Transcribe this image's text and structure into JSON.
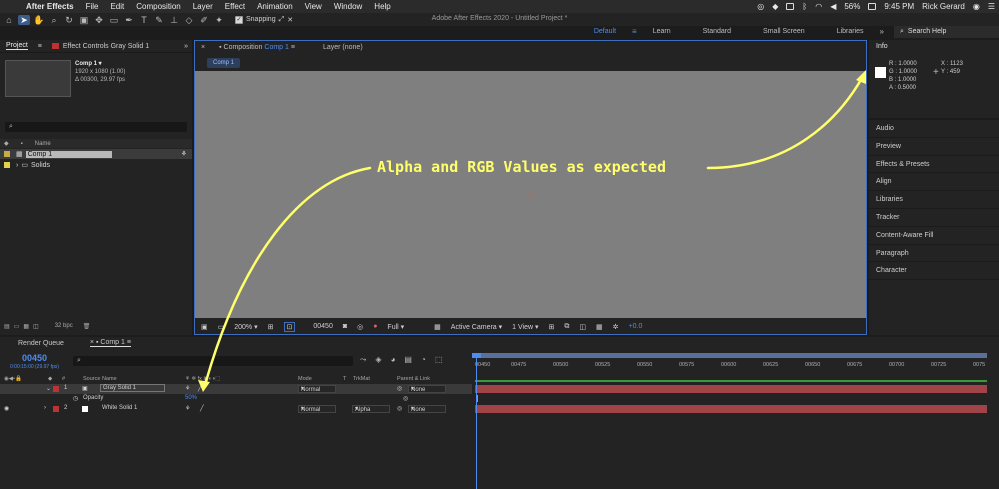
{
  "menubar": {
    "app": "After Effects",
    "items": [
      "File",
      "Edit",
      "Composition",
      "Layer",
      "Effect",
      "Animation",
      "View",
      "Window",
      "Help"
    ],
    "battery": "56%",
    "time": "9:45 PM",
    "user": "Rick Gerard"
  },
  "toolbar": {
    "window_title": "Adobe After Effects 2020 - Untitled Project *",
    "snapping_label": "Snapping"
  },
  "workspaces": {
    "items": [
      "Default",
      "Learn",
      "Standard",
      "Small Screen",
      "Libraries"
    ],
    "active": "Default",
    "search_placeholder": "Search Help"
  },
  "project": {
    "tab_project": "Project",
    "tab_effects": "Effect Controls Gray Solid 1",
    "comp_name": "Comp 1 ▾",
    "comp_res": "1920 x 1080 (1.00)",
    "comp_dur": "Δ 00300, 29.97 fps",
    "search_icon": "⌕",
    "col_name": "Name",
    "items": [
      {
        "name": "Comp 1",
        "color": "#c9a94a"
      },
      {
        "name": "Solids",
        "color": "#e0d24a"
      }
    ],
    "bpc": "32 bpc"
  },
  "viewer": {
    "tab_comp": "Composition",
    "tab_comp_name": "Comp 1",
    "tab_layer": "Layer (none)",
    "pill": "Comp 1",
    "zoom": "200%",
    "frame": "00450",
    "resolution": "Full",
    "camera": "Active Camera",
    "views": "1 View",
    "exposure": "+0.0"
  },
  "info": {
    "title": "Info",
    "r": "R : 1.0000",
    "g": "G : 1.0000",
    "b": "B : 1.0000",
    "a": "A :  0.5000",
    "x": "X : 1123",
    "y": "Y :  459"
  },
  "right_panels": [
    "Audio",
    "Preview",
    "Effects & Presets",
    "Align",
    "Libraries",
    "Tracker",
    "Content-Aware Fill",
    "Paragraph",
    "Character"
  ],
  "timeline": {
    "tab_render": "Render Queue",
    "tab_comp": "Comp 1",
    "timecode": "00450",
    "timecode_sub": "0:00:15:00 (29.97 fps)",
    "cols": {
      "source": "Source Name",
      "mode": "Mode",
      "t": "T",
      "trkmat": "TrkMat",
      "parent": "Parent & Link"
    },
    "layers": [
      {
        "num": "1",
        "name": "Gray Solid 1",
        "mode": "Normal",
        "trkmat": "",
        "parent": "None",
        "color": "#b33"
      },
      {
        "num": "2",
        "name": "White Solid 1",
        "mode": "Normal",
        "trkmat": "Alpha",
        "parent": "None",
        "color": "#fff"
      }
    ],
    "opacity_label": "Opacity",
    "opacity_value": "50%",
    "ruler_ticks": [
      "00450",
      "00475",
      "00500",
      "00525",
      "00550",
      "00575",
      "00600",
      "00625",
      "00650",
      "00675",
      "00700",
      "00725",
      "0075"
    ]
  },
  "annotation": {
    "text": "Alpha and RGB Values as expected",
    "color": "#ffff6b"
  }
}
